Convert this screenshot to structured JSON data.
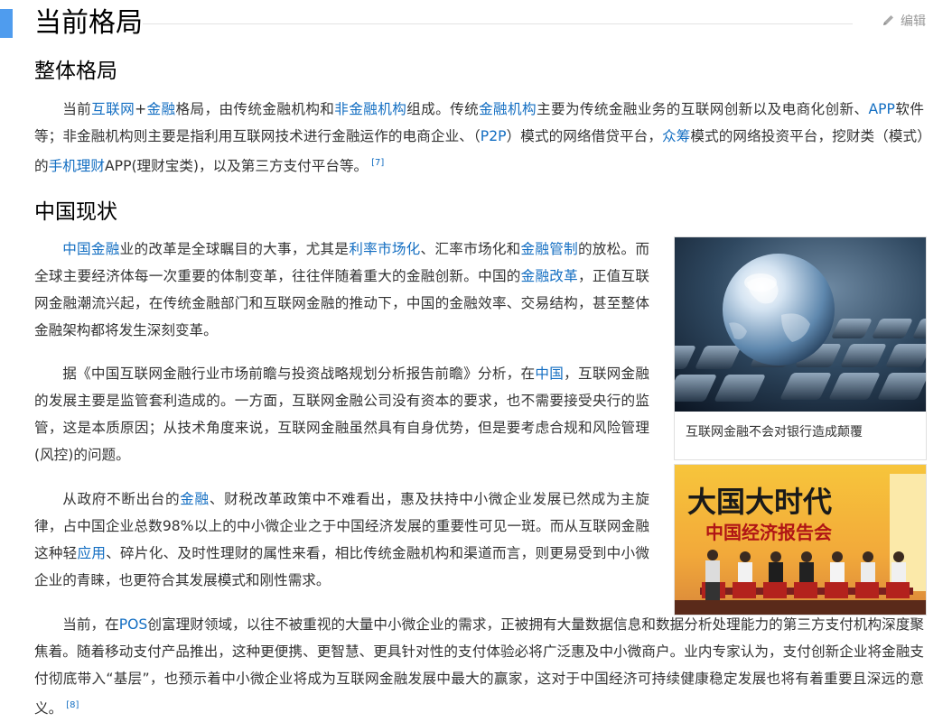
{
  "section": {
    "title": "当前格局",
    "edit_label": "编辑"
  },
  "subsections": [
    {
      "title": "整体格局"
    },
    {
      "title": "中国现状"
    }
  ],
  "paragraphs": {
    "p1": {
      "segs": [
        "当前",
        "互联网",
        "+",
        "金融",
        "格局，由传统金融机构和",
        "非金融机构",
        "组成。传统",
        "金融机构",
        "主要为传统金融业务的互联网创新以及电商化创新、",
        "APP",
        "软件等；非金融机构则主要是指利用互联网技术进行金融运作的电商企业、（",
        "P2P",
        "）模式的网络借贷平台，",
        "众筹",
        "模式的网络投资平台，挖财类（模式）的",
        "手机理财",
        "APP(理财宝类)，以及第三方支付平台等。"
      ],
      "ref": "[7]"
    },
    "p2": {
      "segs": [
        "中国金融",
        "业的改革是全球瞩目的大事，尤其是",
        "利率市场化",
        "、汇率市场化和",
        "金融管制",
        "的放松。而全球主要经济体每一次重要的体制变革，往往伴随着重大的金融创新。中国的",
        "金融改革",
        "，正值互联网金融潮流兴起，在传统金融部门和互联网金融的推动下，中国的金融效率、交易结构，甚至整体金融架构都将发生深刻变革。"
      ]
    },
    "p3": {
      "segs": [
        "据《中国互联网金融行业市场前瞻与投资战略规划分析报告前瞻》分析，在",
        "中国",
        "，互联网金融的发展主要是监管套利造成的。一方面，互联网金融公司没有资本的要求，也不需要接受央行的监管，这是本质原因；从技术角度来说，互联网金融虽然具有自身优势，但是要考虑合规和风险管理(风控)的问题。"
      ]
    },
    "p4": {
      "segs": [
        "从政府不断出台的",
        "金融",
        "、财税改革政策中不难看出，惠及扶持中小微企业发展已然成为主旋律，占中国企业总数98%以上的中小微企业之于中国经济发展的重要性可见一斑。而从互联网金融这种轻",
        "应用",
        "、碎片化、及时性理财的属性来看，相比传统金融机构和渠道而言，则更易受到中小微企业的青睐，也更符合其发展模式和刚性需求。"
      ]
    },
    "p5": {
      "segs": [
        "当前，在",
        "POS",
        "创富理财领域，以往不被重视的大量中小微企业的需求，正被拥有大量数据信息和数据分析处理能力的第三方支付机构深度聚焦着。随着移动支付产品推出，这种更便携、更智慧、更具针对性的支付体验必将广泛惠及中小微商户。业内专家认为，支付创新企业将金融支付彻底带入“基层”，也预示着中小微企业将成为互联网金融发展中最大的赢家，这对于中国经济可持续健康稳定发展也将有着重要且深远的意义。"
      ],
      "ref": "[8]"
    }
  },
  "figures": {
    "fig1": {
      "caption": "互联网金融不会对银行造成颠覆"
    },
    "fig2": {
      "banner_title": "大国大时代",
      "banner_subtitle": "中国经济报告会"
    }
  },
  "colors": {
    "accent": "#4f9cee",
    "link": "#136ec2",
    "text": "#333333"
  }
}
